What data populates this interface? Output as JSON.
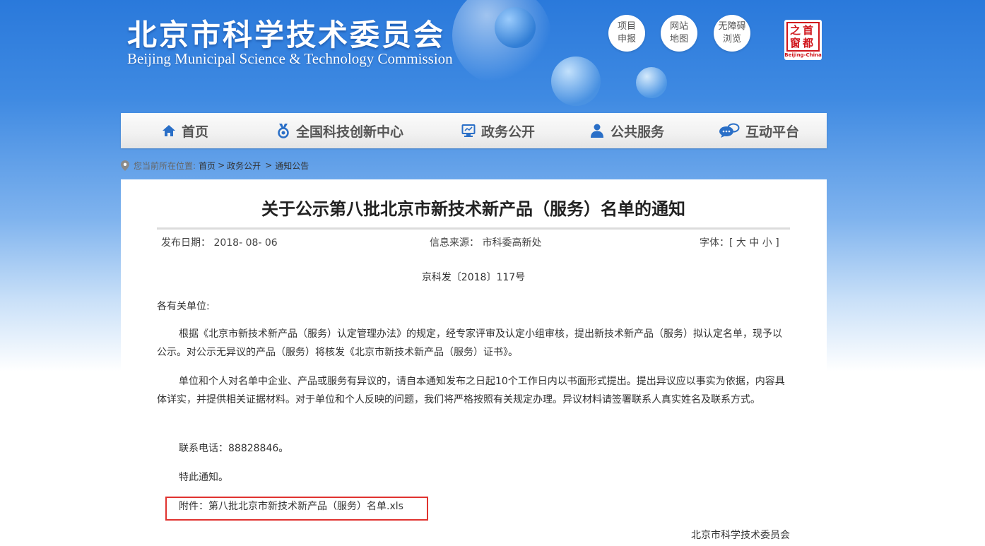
{
  "header": {
    "title_cn": "北京市科学技术委员会",
    "title_en": "Beijing Municipal Science & Technology Commission",
    "quick_links": [
      {
        "line1": "项目",
        "line2": "申报"
      },
      {
        "line1": "网站",
        "line2": "地图"
      },
      {
        "line1": "无障碍",
        "line2": "浏览"
      }
    ],
    "seal": {
      "chars": [
        "首",
        "都",
        "之",
        "窗"
      ],
      "subtitle": "Beijing-China"
    }
  },
  "nav": {
    "items": [
      {
        "label": "首页",
        "icon": "home-icon"
      },
      {
        "label": "全国科技创新中心",
        "icon": "medal-icon"
      },
      {
        "label": "政务公开",
        "icon": "monitor-icon"
      },
      {
        "label": "公共服务",
        "icon": "person-icon"
      },
      {
        "label": "互动平台",
        "icon": "chat-icon"
      }
    ]
  },
  "breadcrumb": {
    "prefix": "您当前所在位置:",
    "items": [
      "首页",
      "政务公开",
      "通知公告"
    ],
    "separator": ">"
  },
  "article": {
    "title": "关于公示第八批北京市新技术新产品（服务）名单的通知",
    "publish_date": "发布日期：  2018- 08- 06",
    "source": "信息来源：  市科委高新处",
    "font_size": "字体：[ 大 中 小 ]",
    "doc_number": "京科发〔2018〕117号",
    "salutation": "各有关单位:",
    "paragraphs": [
      "根据《北京市新技术新产品（服务）认定管理办法》的规定，经专家评审及认定小组审核，提出新技术新产品（服务）拟认定名单，现予以公示。对公示无异议的产品（服务）将核发《北京市新技术新产品（服务）证书》。",
      "单位和个人对名单中企业、产品或服务有异议的，请自本通知发布之日起10个工作日内以书面形式提出。提出异议应以事实为依据，内容具体详实，并提供相关证据材料。对于单位和个人反映的问题，我们将严格按照有关规定办理。异议材料请签署联系人真实姓名及联系方式。"
    ],
    "contact": "联系电话：88828846。",
    "closing": "特此通知。",
    "attachment_label": "附件：",
    "attachment_link": "第八批北京市新技术新产品（服务）名单.xls",
    "signature": "北京市科学技术委员会"
  },
  "colors": {
    "header_blue": "#2a79db",
    "highlight_red": "#e0332f",
    "nav_icon_blue": "#2a6fc7"
  }
}
